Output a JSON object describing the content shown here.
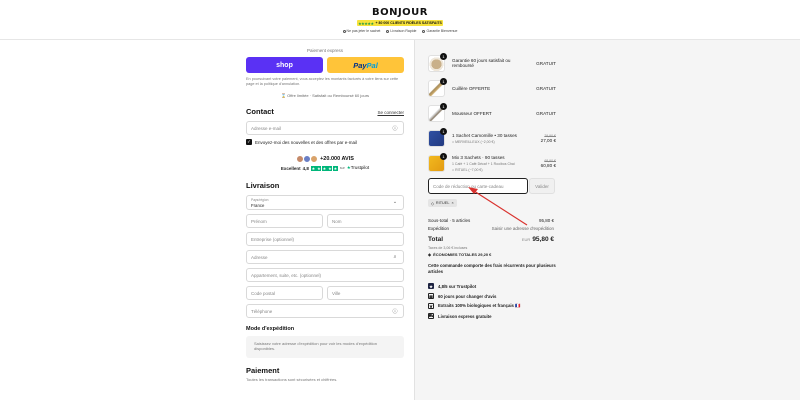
{
  "header": {
    "logo": "BONJOUR",
    "promo_stars": "★★★★★",
    "promo_text": "+ 80 000 CLIENTS FIDÈLES SATISFAITS",
    "badges": [
      "Ne pas jeter le sachet",
      "Livraison Rapide",
      "Garantie Bienvenue"
    ]
  },
  "express": {
    "label": "Paiement express",
    "shop_label": "shop",
    "paypal_a": "Pay",
    "paypal_b": "Pal",
    "legal": "En poursuivant votre paiement, vous acceptez les montants facturés à votre liens sur cette page et la politique d'annulation.",
    "offer": "Offre limitée · Satisfait ou Remboursé 60 jours"
  },
  "contact": {
    "title": "Contact",
    "login": "Se connecter",
    "email_placeholder": "Adresse e-mail",
    "newsletter": "Envoyez-moi des nouvelles et des offres par e-mail"
  },
  "reviews": {
    "count": "+20.000 AVIS",
    "excellent": "Excellent",
    "score": "4,8",
    "stars": "★",
    "sub": "sur",
    "tp": "Trustpilot"
  },
  "delivery": {
    "title": "Livraison",
    "country_label": "Pays/région",
    "country_value": "France",
    "first_name": "Prénom",
    "last_name": "Nom",
    "company": "Entreprise (optionnel)",
    "address": "Adresse",
    "apartment": "Appartement, suite, etc. (optionnel)",
    "postal": "Code postal",
    "city": "Ville",
    "phone": "Téléphone"
  },
  "shipping_method": {
    "title": "Mode d'expédition",
    "note": "Saisissez votre adresse d'expédition pour voir les modes d'expédition disponibles."
  },
  "payment": {
    "title": "Paiement",
    "sub": "Toutes les transactions sont sécurisées et chiffrées."
  },
  "cart": {
    "items": [
      {
        "qty": "1",
        "name": "Garantie 60 jours satisfait ou remboursé",
        "sub": "",
        "old_price": "",
        "price": "GRATUIT"
      },
      {
        "qty": "1",
        "name": "Cuillère OFFERTE",
        "sub": "",
        "old_price": "",
        "price": "GRATUIT"
      },
      {
        "qty": "1",
        "name": "Mousseur OFFERT",
        "sub": "",
        "old_price": "",
        "price": "GRATUIT"
      },
      {
        "qty": "1",
        "name": "1 Sachet Camomille • 30 tasses",
        "sub": "MERVEILLEUX (−2,00 €)",
        "old_price": "29,90 €",
        "price": "27,00 €"
      },
      {
        "qty": "1",
        "name": "Mix 3 Sachets · 90 tasses",
        "sub": "RITUEL (−7,00 €)",
        "sub2": "1 Café + 1 Café Décaf + 1 Rooibos Chai",
        "old_price": "68,90 €",
        "price": "60,80 €"
      }
    ],
    "coupon_placeholder": "Code de réduction ou carte-cadeau",
    "apply": "Valider",
    "discount_tag": "RITUEL",
    "subtotal_label": "Sous-total · 5 articles",
    "subtotal_value": "95,80 €",
    "shipping_label": "Expédition",
    "shipping_value": "Saisir une adresse d'expédition",
    "total_label": "Total",
    "total_currency": "EUR",
    "total_value": "95,80 €",
    "taxes": "Taxes de 3,06 € incluses",
    "savings": "ÉCONOMIES TOTALES  29,20 €",
    "recurring": "Cette commande comporte des frais récurrents pour plusieurs articles",
    "benefits": [
      {
        "icon": "trustpilot-icon",
        "text": "4,8/5 sur Trustpilot"
      },
      {
        "icon": "calendar-icon",
        "text": "60 jours pour changer d'avis"
      },
      {
        "icon": "leaf-icon",
        "text": "Extraits 100% biologiques et français 🇫🇷"
      },
      {
        "icon": "truck-icon",
        "text": "Livraison express gratuite"
      }
    ]
  },
  "colors": {
    "shop": "#5a31f4",
    "paypal": "#ffc439",
    "trustpilot": "#00b67a",
    "annotation_arrow": "#d9322e"
  }
}
